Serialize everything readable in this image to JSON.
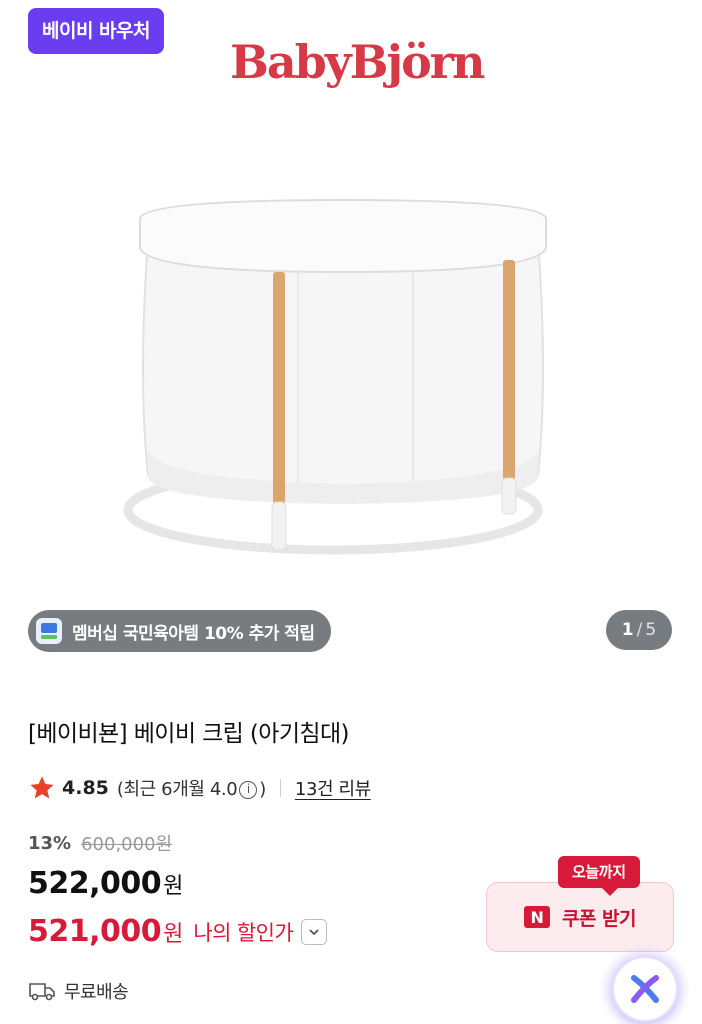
{
  "gallery": {
    "voucher_badge": "베이비 바우처",
    "brand_logo_text": "BabyBjörn",
    "membership_pill": "멤버십 국민육아템 10% 추가 적립",
    "page_current": "1",
    "page_separator": "/",
    "page_total": "5"
  },
  "product": {
    "title": "[베이비뵨] 베이비 크립 (아기침대)",
    "rating": {
      "score": "4.85",
      "recent_prefix": "(최근 6개월 4.0",
      "info_glyph": "i",
      "recent_suffix": ")",
      "review_count": "13건 리뷰"
    },
    "price": {
      "discount_rate": "13%",
      "original_price": "600,000원",
      "sale_price": "522,000",
      "currency": "원",
      "my_price": "521,000",
      "my_discount_label": "나의 할인가"
    },
    "coupon": {
      "badge": "오늘까지",
      "logo_letter": "N",
      "label": "쿠폰 받기"
    },
    "shipping": "무료배송"
  },
  "colors": {
    "voucher_purple": "#6a3df0",
    "brand_red": "#d63a47",
    "price_red": "#d7193a",
    "pill_gray": "#777c80",
    "star_red": "#e8412c"
  },
  "icons": [
    "membership-icon",
    "star-icon",
    "info-icon",
    "chevron-down-icon",
    "naver-n-icon",
    "truck-icon",
    "ai-assistant-icon"
  ]
}
